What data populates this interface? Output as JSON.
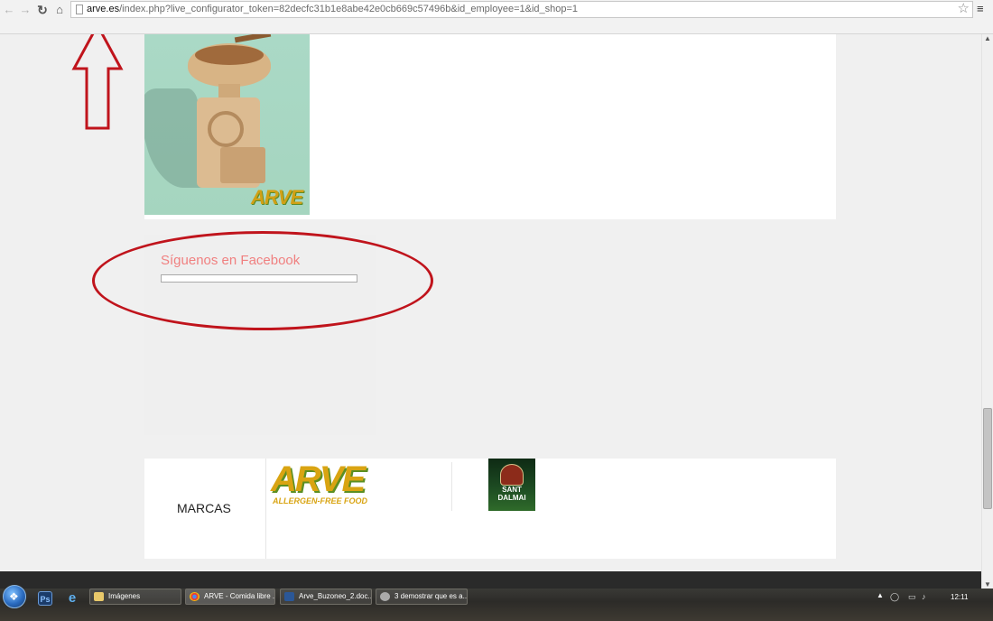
{
  "browser": {
    "url_host": "arve.es",
    "url_path": "/index.php?live_configurator_token=82decfc31b1e8abe42e0cb669c57496b&id_employee=1&id_shop=1",
    "icons": [
      "back-arrow-icon",
      "forward-arrow-icon",
      "reload-icon",
      "home-icon",
      "page-icon",
      "bookmark-star-icon",
      "menu-icon"
    ]
  },
  "page": {
    "product_logo": "ARVE",
    "facebook_title": "Síguenos en Facebook",
    "brands_title": "MARCAS",
    "brands": [
      {
        "name": "ARVE",
        "tagline": "ALLERGEN-FREE FOOD"
      },
      {
        "name": "SANT DALMAI",
        "line1": "SANT",
        "line2": "DALMAI"
      }
    ]
  },
  "annotations": {
    "color": "#c0141c",
    "shapes": [
      "arrow-up",
      "ellipse"
    ]
  },
  "taskbar": {
    "tasks": [
      {
        "label": "Imágenes"
      },
      {
        "label": "ARVE - Comida libre ..."
      },
      {
        "label": "Arve_Buzoneo_2.doc..."
      },
      {
        "label": "3 demostrar que es a..."
      }
    ],
    "clock": "12:11"
  }
}
